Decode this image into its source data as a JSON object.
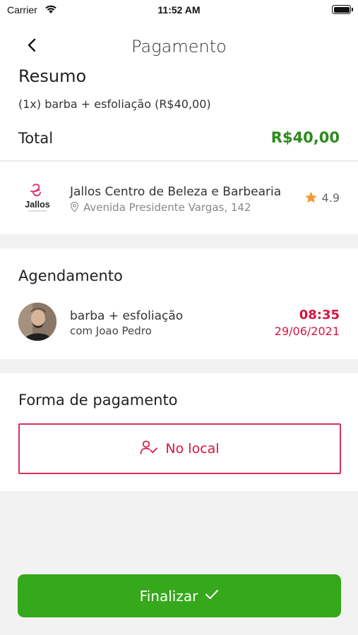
{
  "status_bar": {
    "carrier": "Carrier",
    "time": "11:52 AM"
  },
  "header": {
    "title": "Pagamento"
  },
  "summary": {
    "heading": "Resumo",
    "item": "(1x) barba + esfoliação  (R$40,00)",
    "total_label": "Total",
    "total_value": "R$40,00"
  },
  "shop": {
    "logo_text": "Jallos",
    "name": "Jallos Centro de Beleza e Barbearia",
    "address": "Avenida Presidente Vargas, 142",
    "rating": "4.9"
  },
  "appointment": {
    "heading": "Agendamento",
    "service": "barba + esfoliação",
    "professional": "com Joao Pedro",
    "time": "08:35",
    "date": "29/06/2021"
  },
  "payment": {
    "heading": "Forma de pagamento",
    "option_label": "No local"
  },
  "finish_button": {
    "label": "Finalizar"
  },
  "colors": {
    "accent_green": "#35a81b",
    "total_green": "#2e8b1f",
    "accent_red": "#d9143f",
    "star_orange": "#f29a38"
  },
  "icons": [
    "wifi-icon",
    "battery-icon",
    "back-chevron-icon",
    "location-pin-icon",
    "star-icon",
    "user-check-icon",
    "checkmark-icon"
  ]
}
